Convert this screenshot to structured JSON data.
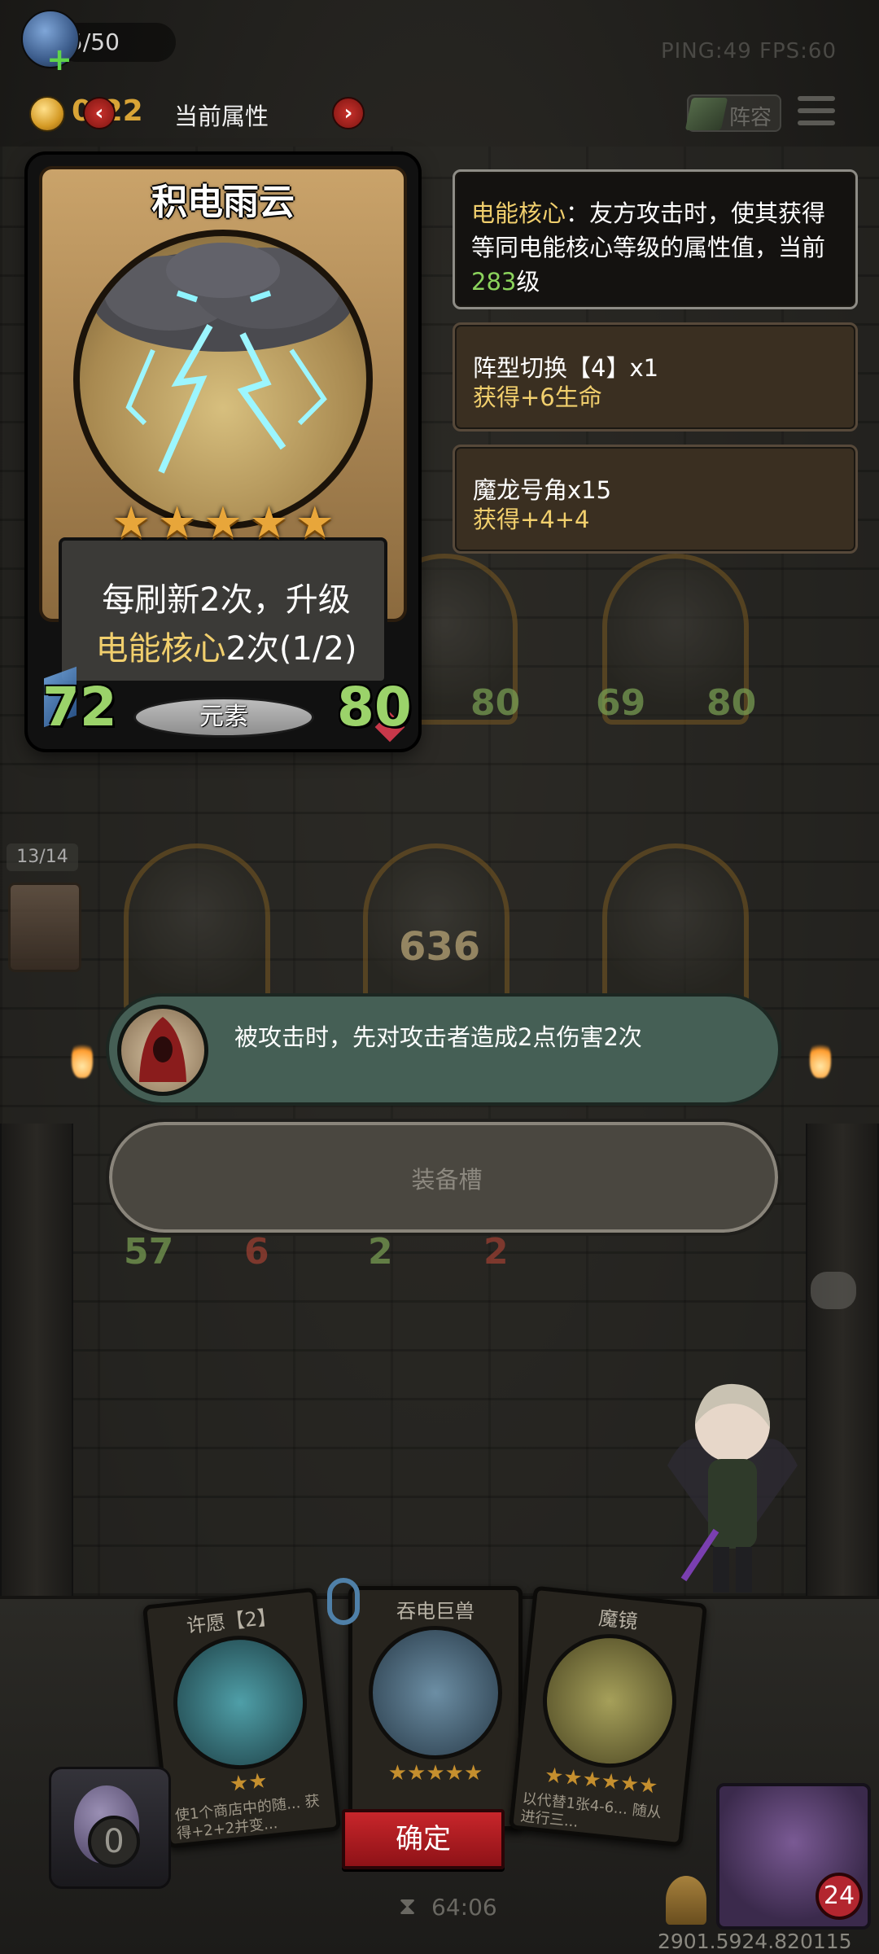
{
  "top_bar": {
    "population": "5/50",
    "net_stats": "PING:49   FPS:60",
    "gold": "0 22",
    "attr_title": "当前属性",
    "prev_arrow": "‹",
    "next_arrow": "›",
    "lineup_label": "阵容"
  },
  "card": {
    "name": "积电雨云",
    "stars": [
      "★",
      "★",
      "★",
      "★",
      "★"
    ],
    "desc_line1": "每刷新2次，升级",
    "desc_keyword": "电能核心",
    "desc_rest": "2次(1/2)",
    "attack": "72",
    "health": "80",
    "tribe": "元素"
  },
  "info_panels": {
    "core": {
      "keyword": "电能核心",
      "text": "：友方攻击时，使其获得等同电能核心等级的属性值，当前",
      "level": "283",
      "level_suffix": "级"
    },
    "formation": {
      "title": "阵型切换【4】x1",
      "sub": "获得+6生命"
    },
    "horn": {
      "title": "魔龙号角x15",
      "sub": "获得+4+4"
    }
  },
  "board": {
    "counter": "13/14",
    "big_number": "636",
    "stats": {
      "m1_atk": "80",
      "m2_atk": "69",
      "m2_hp": "80",
      "m3_atk": "57",
      "m3_hp": "6",
      "m4_atk": "2",
      "m4_hp": "2"
    }
  },
  "ability": {
    "text": "被攻击时，先对攻击者造成2点伤害2次"
  },
  "equip": {
    "label": "装备槽"
  },
  "shop": {
    "cards": [
      {
        "title": "许愿【2】",
        "stars": "★★",
        "desc": "使1个商店中的随... 获得+2+2并变..."
      },
      {
        "title": "吞电巨兽",
        "stars": "★★★★★",
        "desc": ""
      },
      {
        "title": "魔镜",
        "stars": "★★★★★★",
        "desc": "以代替1张4-6... 随从 进行三..."
      }
    ],
    "confirm_label": "确定",
    "egg_count": "0",
    "timer": "64:06",
    "opp_badge": "24",
    "build_id": "2901.5924.820115"
  },
  "colors": {
    "gold_keyword": "#f1cf6d",
    "green_keyword": "#8bd35c",
    "ability_bg": "#455f55",
    "confirm_red": "#c8262b"
  },
  "icons": [
    "plus-icon",
    "coin-icon",
    "menu-icon",
    "chat-icon",
    "link-icon",
    "egg-icon",
    "timer-icon",
    "sword-icon"
  ]
}
